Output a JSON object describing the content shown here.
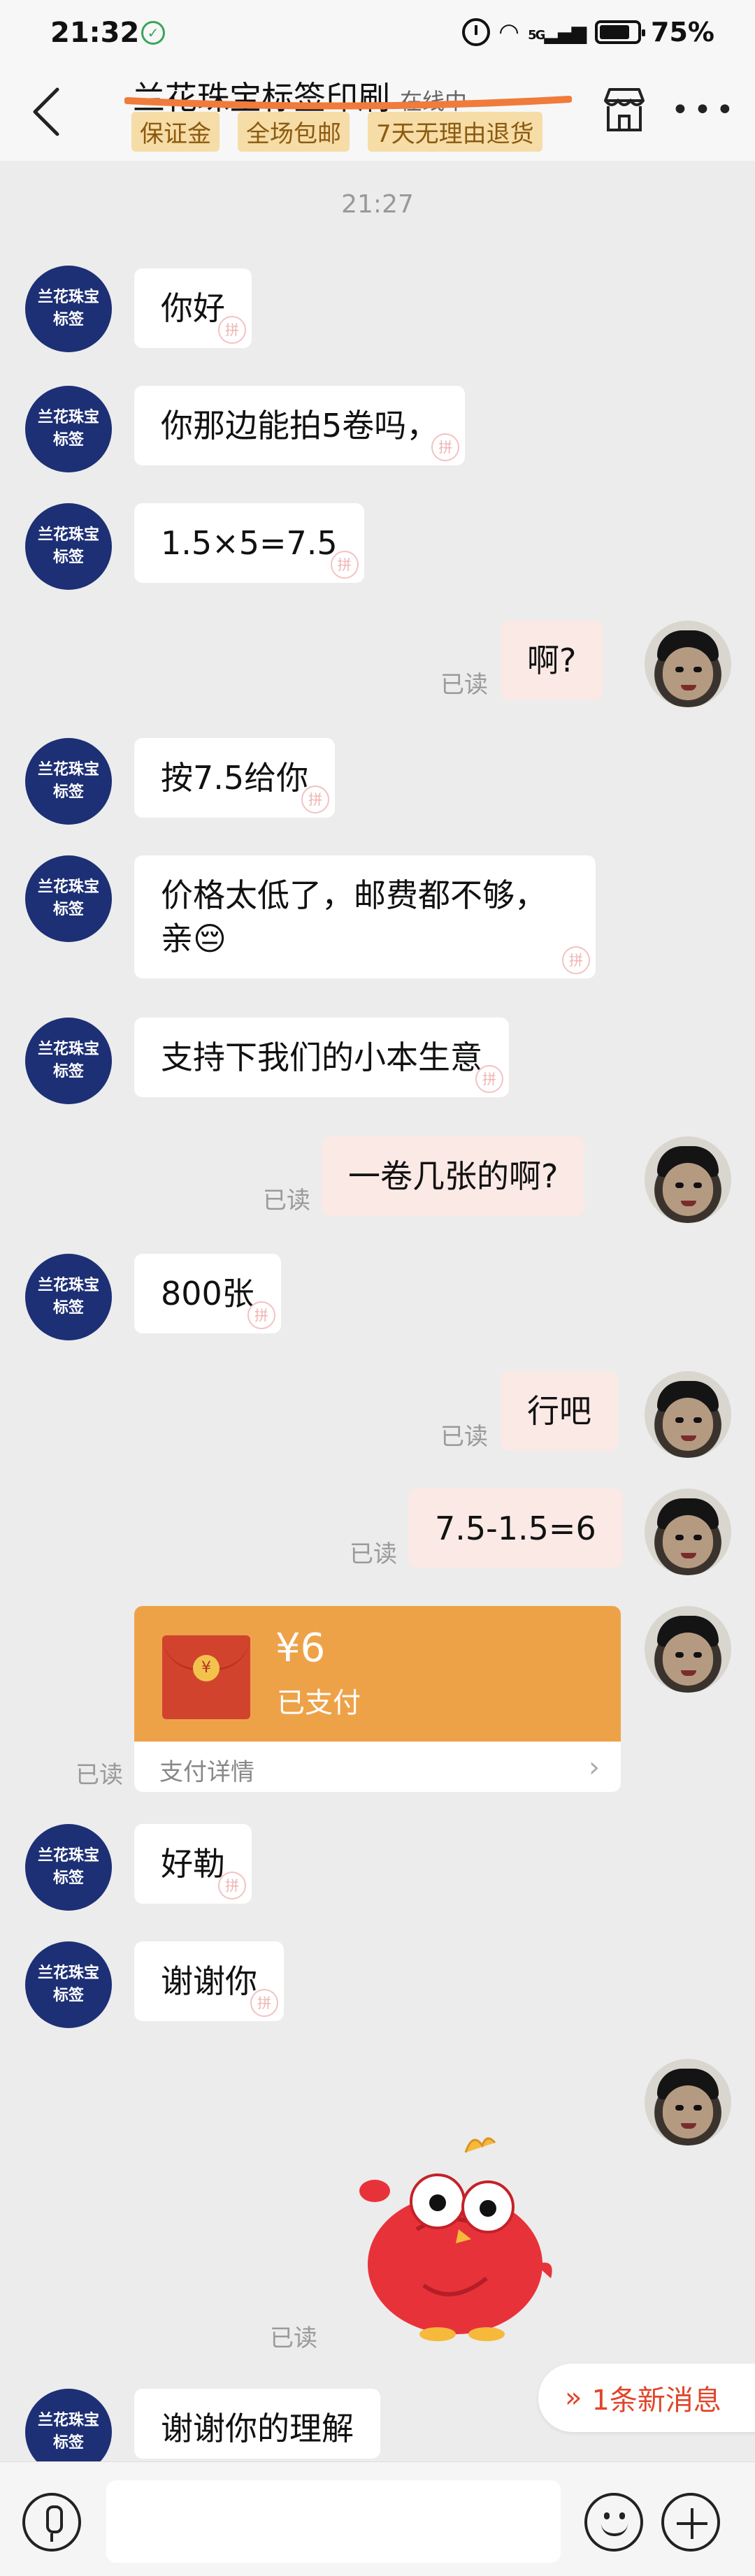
{
  "status_bar": {
    "time": "21:32",
    "network": "5G",
    "battery": "75%"
  },
  "header": {
    "title": "兰花珠宝标签印刷",
    "status": "在线中",
    "tags": [
      "保证金",
      "全场包邮",
      "7天无理由退货"
    ]
  },
  "chat": {
    "time_divider": "21:27",
    "shop_avatar_text": "兰花珠宝标签",
    "read_label": "已读",
    "messages": [
      {
        "side": "left",
        "text": "你好"
      },
      {
        "side": "left",
        "text": "你那边能拍5卷吗，"
      },
      {
        "side": "left",
        "text": "1.5×5=7.5"
      },
      {
        "side": "right",
        "text": "啊?",
        "read": "已读"
      },
      {
        "side": "left",
        "text": "按7.5给你"
      },
      {
        "side": "left",
        "text": "价格太低了，邮费都不够，亲😔"
      },
      {
        "side": "left",
        "text": "支持下我们的小本生意"
      },
      {
        "side": "right",
        "text": "一卷几张的啊?",
        "read": "已读"
      },
      {
        "side": "left",
        "text": "800张"
      },
      {
        "side": "right",
        "text": "行吧",
        "read": "已读"
      },
      {
        "side": "right",
        "text": "7.5-1.5=6",
        "read": "已读"
      },
      {
        "side": "right",
        "type": "payment",
        "amount": "¥6",
        "status": "已支付",
        "detail": "支付详情",
        "read": "已读"
      },
      {
        "side": "left",
        "text": "好勒"
      },
      {
        "side": "left",
        "text": "谢谢你"
      },
      {
        "side": "right",
        "type": "sticker",
        "read": "已读"
      },
      {
        "side": "left",
        "text": "谢谢你的理解"
      }
    ],
    "watermark": "拼"
  },
  "new_message_pill": "1条新消息",
  "input": {
    "placeholder": ""
  },
  "colors": {
    "shop_avatar": "#1d2f75",
    "right_bubble": "#fbe9e6",
    "payment_card": "#eea248",
    "tag_bg": "#f6dca6",
    "accent_red": "#e0462a",
    "title_strike": "#f07b3a"
  }
}
